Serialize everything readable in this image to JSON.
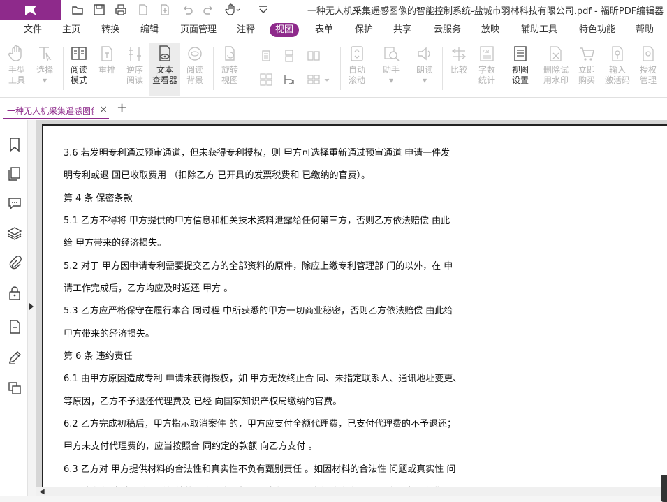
{
  "titlebar": {
    "title": "一种无人机采集遥感图像的智能控制系统-盐城市羽林科技有限公司.pdf - 福昕PDF编辑器（未经",
    "quick_access": [
      "open-icon",
      "save-icon",
      "print-icon",
      "new-doc-icon",
      "import-icon",
      "undo-icon",
      "redo-icon",
      "hand-tool-icon",
      "customize-icon"
    ]
  },
  "menu": {
    "items": [
      "文件",
      "主页",
      "转换",
      "编辑",
      "页面管理",
      "注释",
      "视图",
      "表单",
      "保护",
      "共享",
      "云服务",
      "放映",
      "辅助工具",
      "特色功能",
      "帮助"
    ],
    "active": "视图"
  },
  "ribbon": {
    "hand_tool": "手型\n工具",
    "select": "选择",
    "reading_mode": "阅读\n模式",
    "reflow": "重排",
    "reverse_read": "逆序\n阅读",
    "text_viewer": "文本\n查看器",
    "read_background": "阅读\n背景",
    "rotate_view": "旋转\n视图",
    "auto_scroll": "自动\n滚动",
    "assistant": "助手",
    "read_aloud": "朗读",
    "compare": "比较",
    "word_count": "字数\n统计",
    "view_settings": "视图\n设置",
    "remove_watermark": "删除试\n用水印",
    "buy_now": "立即\n购买",
    "enter_code": "输入\n激活码",
    "license_mgmt": "授权\n管理"
  },
  "tabs": {
    "doc_tab": "一种无人机采集遥感图像的智能控制系统-盐城市羽林科技有限公司.pdf",
    "close": "×",
    "add": "+"
  },
  "document": {
    "lines": [
      "3.6 若发明专利通过预审通道，但未获得专利授权，则 甲方可选择重新通过预审通道 申请一件发",
      "明专利或退 回已收取费用          （扣除乙方 已开具的发票税费和 已缴纳的官费）。",
      "第 4 条  保密条款",
      "5.1 乙方不得将 甲方提供的甲方信息和相关技术资料泄露给任何第三方，否则乙方依法赔偿 由此",
      "给 甲方带来的经济损失。",
      "5.2  对于 甲方因申请专利需要提交乙方的全部资料的原件，除应上缴专利管理部 门的以外，在 申",
      "请工作完成后，乙方均应及时返还 甲方 。",
      "5.3 乙方应严格保守在履行本合 同过程 中所获悉的甲方一切商业秘密，否则乙方依法赔偿 由此给",
      "甲方带来的经济损失。",
      "第 6 条  违约责任",
      "6.1 由甲方原因造成专利 申请未获得授权，如 甲方无故终止合 同、未指定联系人、通讯地址变更、",
      "等原因，乙方不予退还代理费及 已经 向国家知识产权局缴纳的官费。",
      "6.2 乙方完成初稿后，甲方指示取消案件 的，甲方应支付全额代理费，已支付代理费的不予退还；",
      "甲方未支付代理费的，应当按照合 同约定的款额 向乙方支付 。",
      "6.3 乙方对 甲方提供材料的合法性和真实性不负有甄别责任 。如因材料的合法性 问题或真实性 问",
      "题导致专利 申请无法正常继续的，由甲方承担一切责任，乙方有权终止合 同，甲方所交所有费用"
    ]
  },
  "colors": {
    "brand": "#8e2a8b",
    "active_menu_bg": "#8e2a8b",
    "disabled_label": "#b5b5b5"
  }
}
